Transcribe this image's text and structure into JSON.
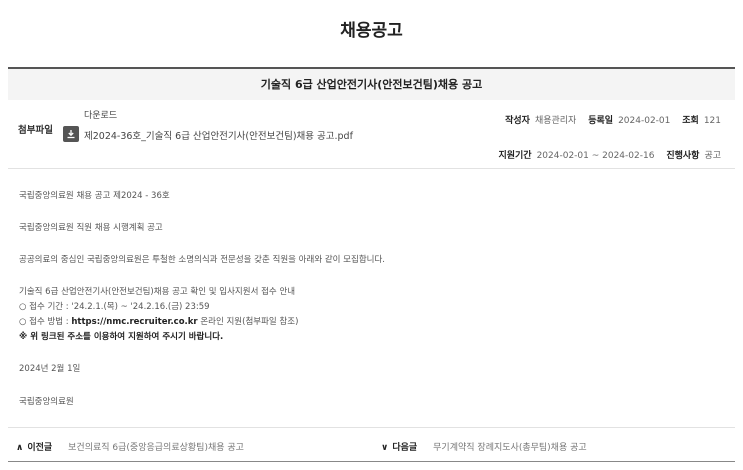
{
  "page_title": "채용공고",
  "post": {
    "title": "기술직 6급 산업안전기사(안전보건팀)채용 공고"
  },
  "attachment": {
    "label": "첨부파일",
    "download_label": "다운로드",
    "icon": "download-icon",
    "file_name": "제2024-36호_기술직 6급 산업안전기사(안전보건팀)채용 공고.pdf"
  },
  "meta": {
    "author_label": "작성자",
    "author": "채용관리자",
    "date_label": "등록일",
    "date": "2024-02-01",
    "views_label": "조회",
    "views": "121",
    "period_label": "지원기간",
    "period": "2024-02-01 ~ 2024-02-16",
    "status_label": "진행사항",
    "status": "공고"
  },
  "body": {
    "line1": "국립중앙의료원 채용 공고 제2024 - 36호",
    "line2": "국립중앙의료원 직원 채용 시행계획 공고",
    "line3": "공공의료의 중심인 국립중앙의료원은 투철한 소명의식과 전문성을 갖춘 직원을 아래와 같이 모집합니다.",
    "line4": "기술직 6급 산업안전기사(안전보건팀)채용 공고 확인 및 입사지원서 접수 안내",
    "line5": "○ 접수 기간 : '24.2.1.(목) ~ '24.2.16.(금) 23:59",
    "line6_prefix": "○ 접수 방법 : ",
    "line6_url": "https://nmc.recruiter.co.kr",
    "line6_suffix": " 온라인 지원(첨부파일 참조)",
    "line7": "※ 위 링크된 주소를 이용하여 지원하여 주시기 바랍니다.",
    "line8": "2024년 2월 1일",
    "line9": "국립중앙의료원"
  },
  "nav": {
    "prev_chevron": "∧",
    "prev_label": "이전글",
    "prev_title": "보건의료직 6급(중앙응급의료상황팀)채용 공고",
    "next_chevron": "∨",
    "next_label": "다음글",
    "next_title": "무기계약직 장례지도사(총무팀)채용 공고"
  }
}
